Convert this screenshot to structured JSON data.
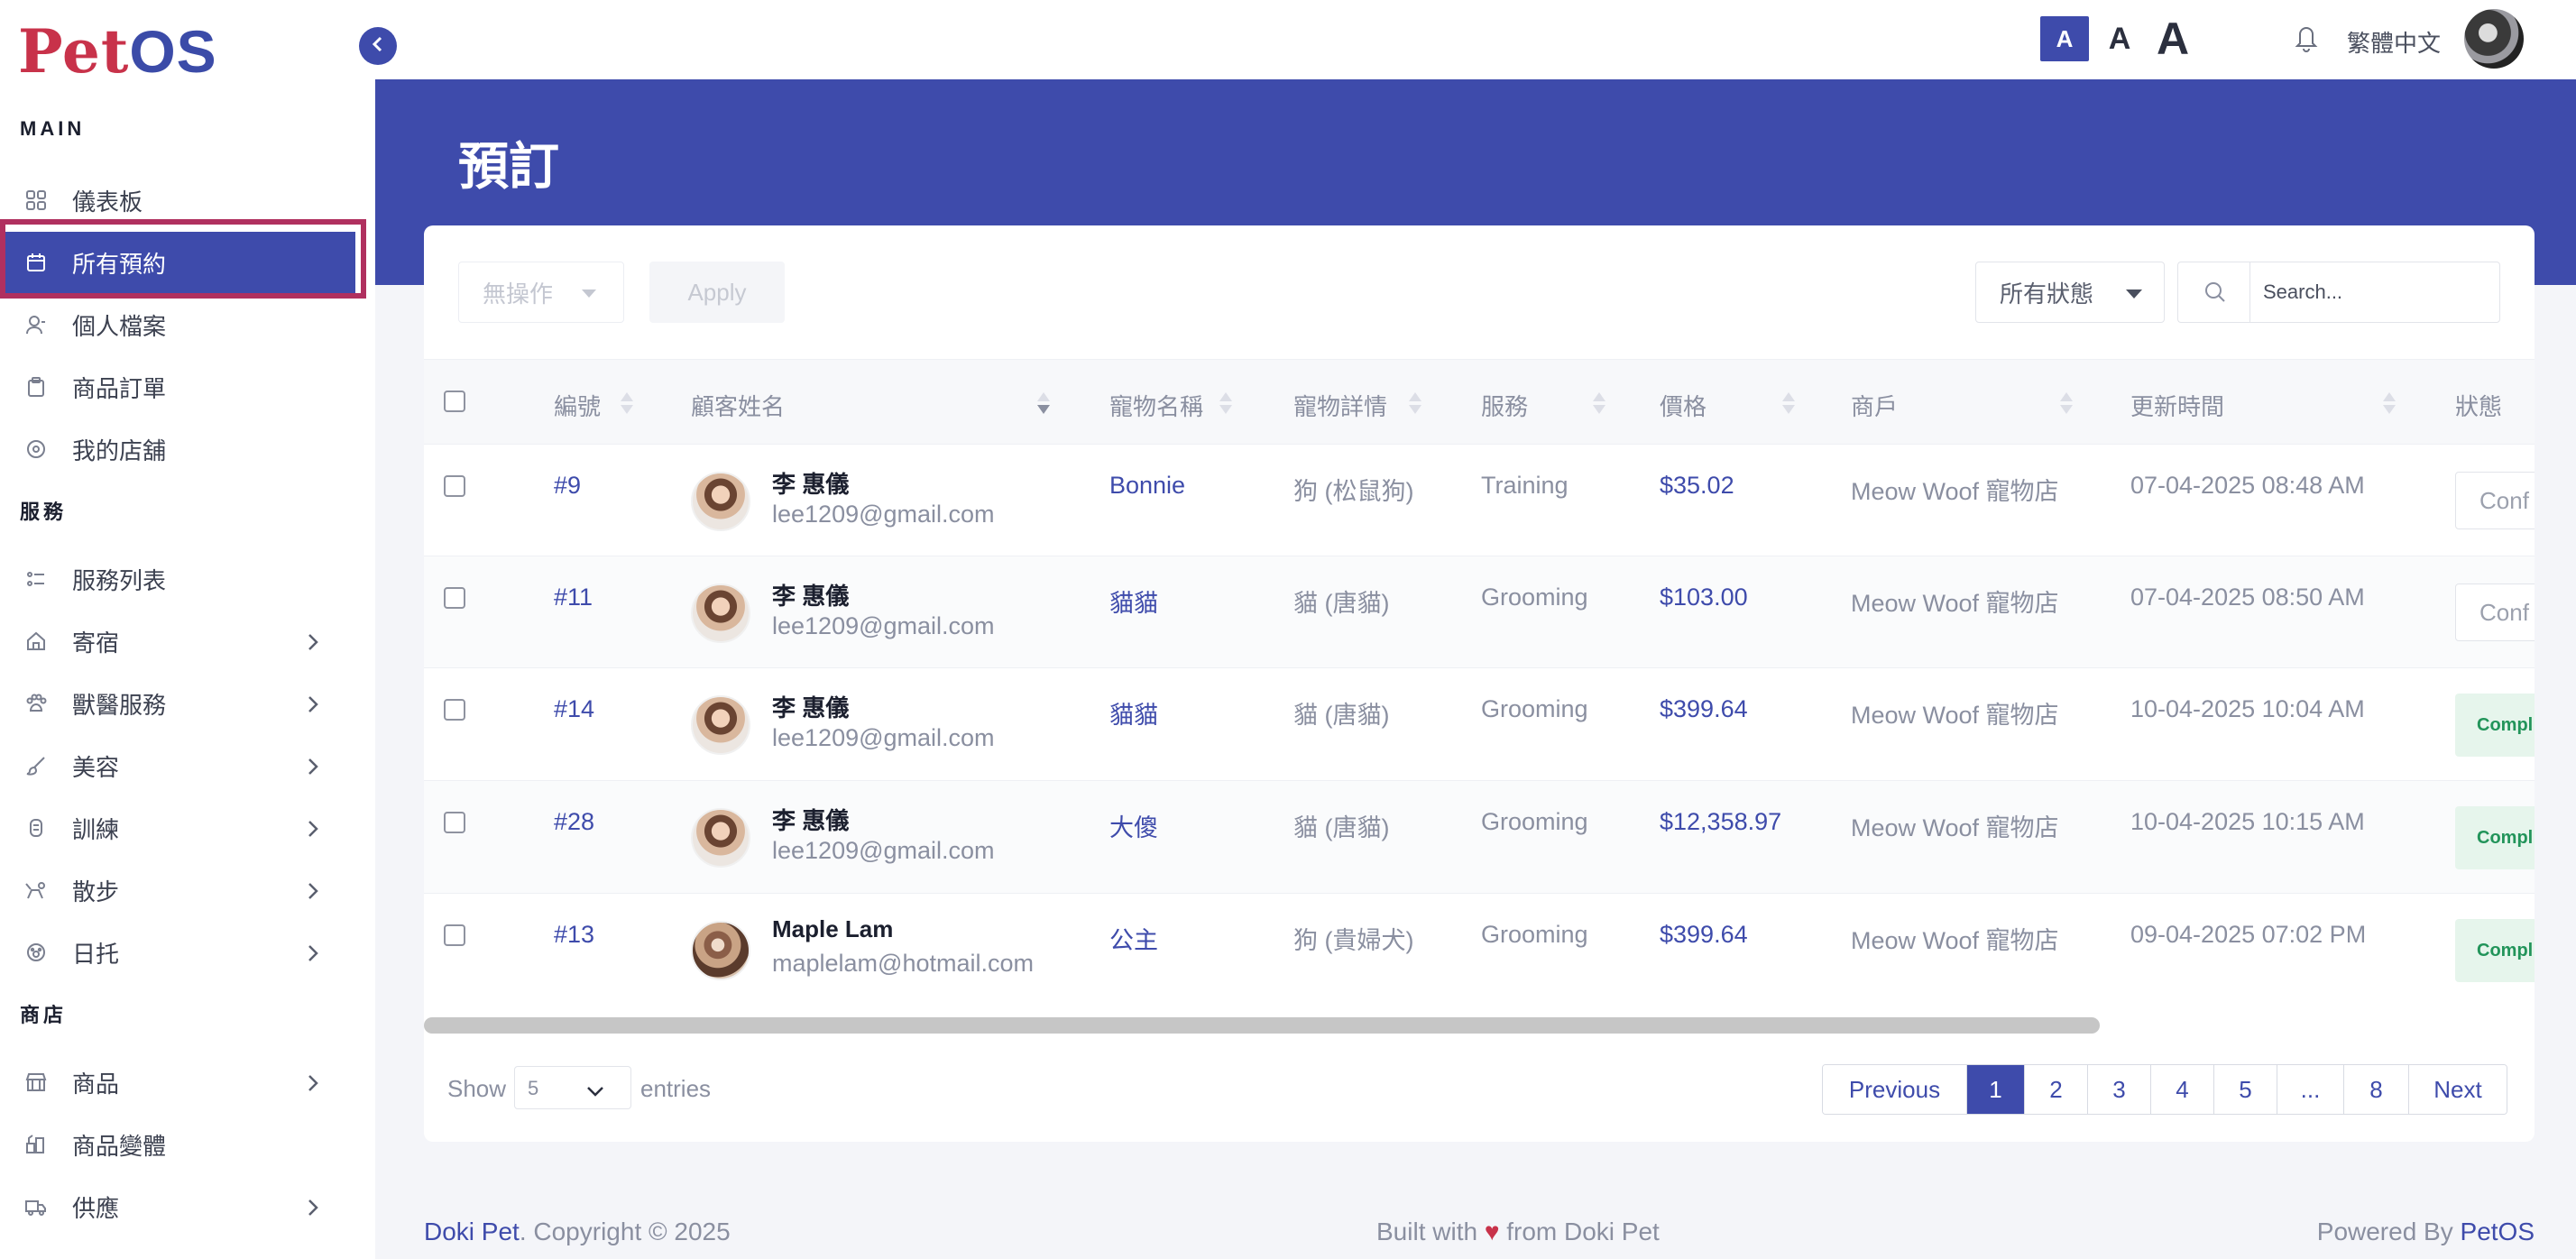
{
  "app": {
    "logo_part1": "Pet",
    "logo_part2": "OS",
    "language": "繁體中文",
    "font_sizes": [
      "A",
      "A",
      "A"
    ]
  },
  "sidebar": {
    "sections": [
      "MAIN",
      "服務",
      "商店"
    ],
    "items": [
      {
        "label": "儀表板",
        "icon": "grid-icon"
      },
      {
        "label": "所有預約",
        "icon": "calendar-icon",
        "active": true
      },
      {
        "label": "個人檔案",
        "icon": "user-icon"
      },
      {
        "label": "商品訂單",
        "icon": "clipboard-icon"
      },
      {
        "label": "我的店舖",
        "icon": "store-icon"
      },
      {
        "label": "服務列表",
        "icon": "list-icon"
      },
      {
        "label": "寄宿",
        "icon": "house-icon",
        "expandable": true
      },
      {
        "label": "獸醫服務",
        "icon": "paw-icon",
        "expandable": true
      },
      {
        "label": "美容",
        "icon": "brush-icon",
        "expandable": true
      },
      {
        "label": "訓練",
        "icon": "medal-icon",
        "expandable": true
      },
      {
        "label": "散步",
        "icon": "dog-walk-icon",
        "expandable": true
      },
      {
        "label": "日托",
        "icon": "paw-circle-icon",
        "expandable": true
      },
      {
        "label": "商品",
        "icon": "shop-icon",
        "expandable": true
      },
      {
        "label": "商品變體",
        "icon": "variants-icon"
      },
      {
        "label": "供應",
        "icon": "truck-icon",
        "expandable": true
      }
    ]
  },
  "page": {
    "title": "預訂"
  },
  "toolbar": {
    "bulk_action": "無操作",
    "apply_label": "Apply",
    "status_filter": "所有狀態",
    "search_placeholder": "Search..."
  },
  "table": {
    "headers": [
      "編號",
      "顧客姓名",
      "寵物名稱",
      "寵物詳情",
      "服務",
      "價格",
      "商戶",
      "更新時間",
      "狀態"
    ],
    "rows": [
      {
        "id": "#9",
        "name": "李 惠儀",
        "email": "lee1209@gmail.com",
        "pet": "Bonnie",
        "detail": "狗 (松鼠狗)",
        "service": "Training",
        "price": "$35.02",
        "shop": "Meow Woof 寵物店",
        "updated": "07-04-2025 08:48 AM",
        "status": "Conf",
        "status_type": "button"
      },
      {
        "id": "#11",
        "name": "李 惠儀",
        "email": "lee1209@gmail.com",
        "pet": "貓貓",
        "detail": "貓 (唐貓)",
        "service": "Grooming",
        "price": "$103.00",
        "shop": "Meow Woof 寵物店",
        "updated": "07-04-2025 08:50 AM",
        "status": "Conf",
        "status_type": "button"
      },
      {
        "id": "#14",
        "name": "李 惠儀",
        "email": "lee1209@gmail.com",
        "pet": "貓貓",
        "detail": "貓 (唐貓)",
        "service": "Grooming",
        "price": "$399.64",
        "shop": "Meow Woof 寵物店",
        "updated": "10-04-2025 10:04 AM",
        "status": "Compl",
        "status_type": "badge"
      },
      {
        "id": "#28",
        "name": "李 惠儀",
        "email": "lee1209@gmail.com",
        "pet": "大傻",
        "detail": "貓 (唐貓)",
        "service": "Grooming",
        "price": "$12,358.97",
        "shop": "Meow Woof 寵物店",
        "updated": "10-04-2025 10:15 AM",
        "status": "Compl",
        "status_type": "badge"
      },
      {
        "id": "#13",
        "name": "Maple Lam",
        "email": "maplelam@hotmail.com",
        "pet": "公主",
        "detail": "狗 (貴婦犬)",
        "service": "Grooming",
        "price": "$399.64",
        "shop": "Meow Woof 寵物店",
        "updated": "09-04-2025 07:02 PM",
        "status": "Compl",
        "status_type": "badge"
      }
    ]
  },
  "pagination": {
    "show_label": "Show",
    "entries_value": "5",
    "entries_label": "entries",
    "previous": "Previous",
    "pages": [
      "1",
      "2",
      "3",
      "4",
      "5",
      "...",
      "8"
    ],
    "next": "Next"
  },
  "footer": {
    "brand": "Doki Pet",
    "copyright": ". Copyright © 2025",
    "built_with": "Built with",
    "heart": "♥",
    "from": "from Doki Pet",
    "powered_by": "Powered By",
    "powered_brand": "PetOS"
  },
  "colors": {
    "primary": "#3e4bab",
    "logo_red": "#c8324a",
    "highlight_outline": "#b0305f",
    "complete_badge": "#22945a"
  }
}
